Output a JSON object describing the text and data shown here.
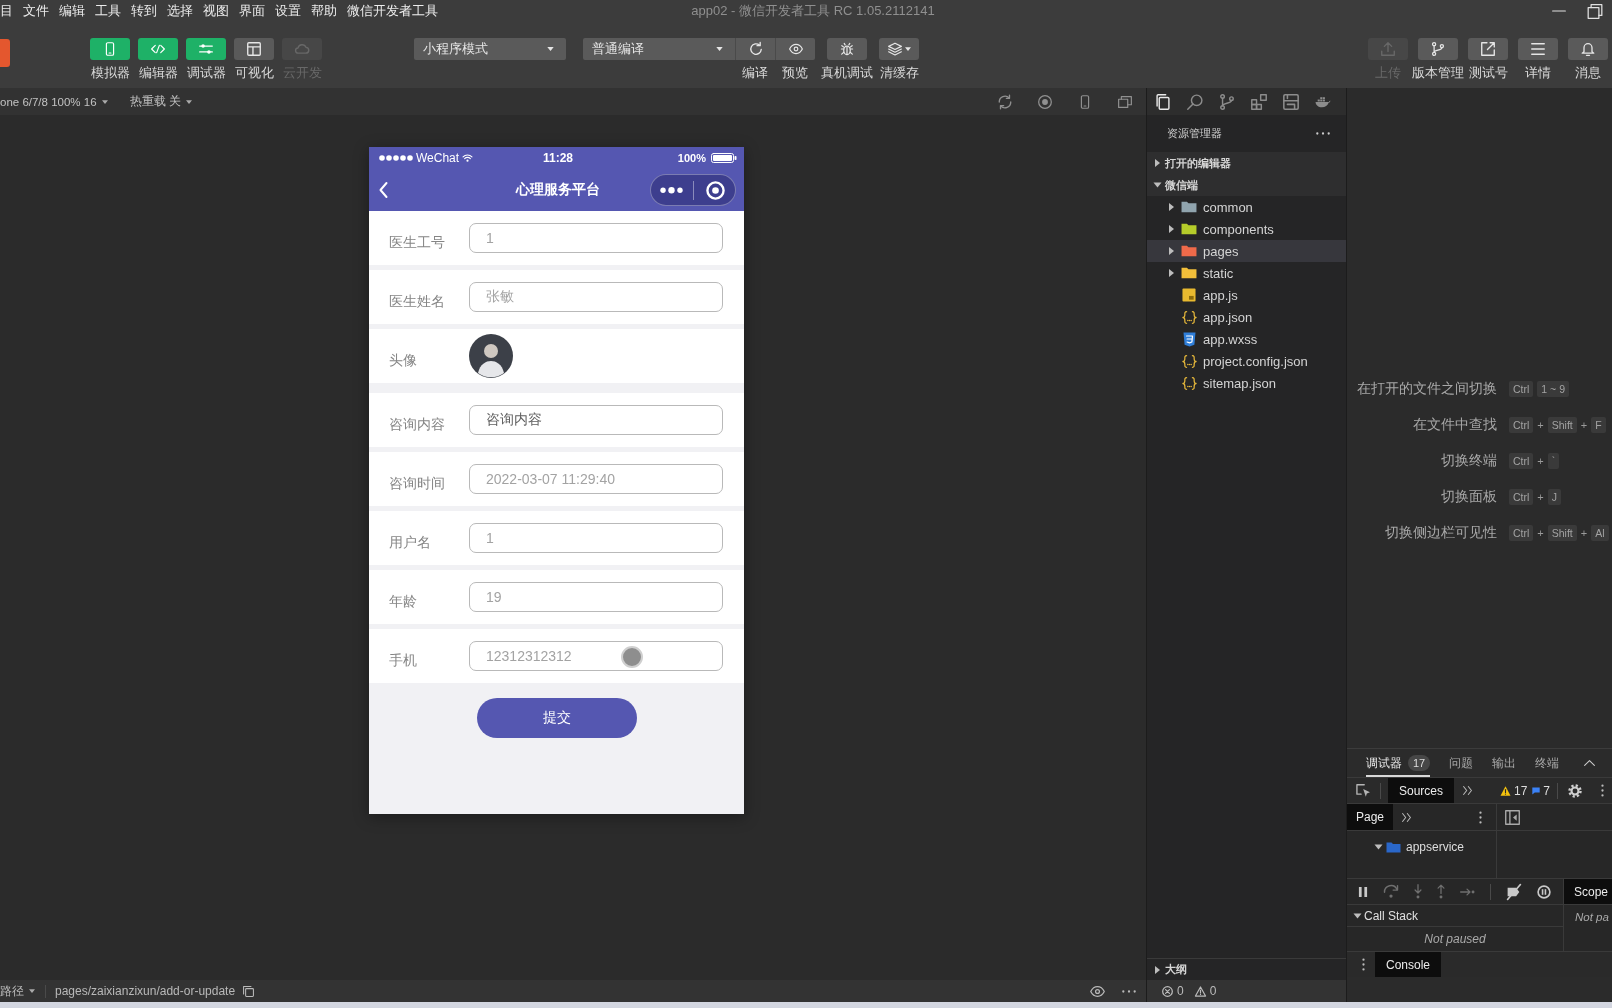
{
  "menu_bar": {
    "items": [
      "目",
      "文件",
      "编辑",
      "工具",
      "转到",
      "选择",
      "视图",
      "界面",
      "设置",
      "帮助",
      "微信开发者工具"
    ],
    "title": "app02 - 微信开发者工具 RC 1.05.2112141"
  },
  "toolbar": {
    "view_toggles": [
      {
        "label": "模拟器",
        "kind": "simulator",
        "on": true,
        "disabled": false
      },
      {
        "label": "编辑器",
        "kind": "editor",
        "on": true,
        "disabled": false
      },
      {
        "label": "调试器",
        "kind": "debugger",
        "on": true,
        "disabled": false
      },
      {
        "label": "可视化",
        "kind": "visual",
        "on": false,
        "disabled": false
      },
      {
        "label": "云开发",
        "kind": "cloud",
        "on": false,
        "disabled": true
      }
    ],
    "mode_select": {
      "value": "小程序模式"
    },
    "compile_select": {
      "value": "普通编译"
    },
    "compile_actions": [
      {
        "label": "编译",
        "kind": "refresh"
      },
      {
        "label": "预览",
        "kind": "preview"
      }
    ],
    "tools": [
      {
        "label": "真机调试",
        "kind": "debug"
      },
      {
        "label": "清缓存",
        "kind": "cache"
      }
    ],
    "right_actions": [
      {
        "label": "上传",
        "kind": "upload",
        "disabled": true
      },
      {
        "label": "版本管理",
        "kind": "version",
        "disabled": false
      },
      {
        "label": "测试号",
        "kind": "test",
        "disabled": false
      },
      {
        "label": "详情",
        "kind": "details",
        "disabled": false
      },
      {
        "label": "消息",
        "kind": "messages",
        "disabled": false
      }
    ]
  },
  "simulator_bar": {
    "device": "one 6/7/8 100% 16",
    "hot_reload": "热重载 关"
  },
  "phone": {
    "status_bar": {
      "carrier": "WeChat",
      "time": "11:28",
      "battery": "100%"
    },
    "nav_title": "心理服务平台",
    "form": [
      {
        "label": "医生工号",
        "kind": "input",
        "value": "1",
        "disabled": true
      },
      {
        "label": "医生姓名",
        "kind": "input",
        "value": "张敏",
        "disabled": true
      },
      {
        "label": "头像",
        "kind": "image"
      },
      {
        "label": "咨询内容",
        "kind": "input",
        "placeholder": "咨询内容",
        "disabled": false
      },
      {
        "label": "咨询时间",
        "kind": "input",
        "value": "2022-03-07 11:29:40",
        "disabled": true
      },
      {
        "label": "用户名",
        "kind": "input",
        "value": "1",
        "disabled": true
      },
      {
        "label": "年龄",
        "kind": "input",
        "value": "19",
        "disabled": true
      },
      {
        "label": "手机",
        "kind": "input",
        "value": "12312312312",
        "disabled": true
      }
    ],
    "submit": "提交"
  },
  "explorer": {
    "title": "资源管理器",
    "sections": [
      {
        "label": "打开的编辑器",
        "expanded": false
      },
      {
        "label": "微信端",
        "expanded": true,
        "children": [
          {
            "label": "common",
            "kind": "folder",
            "color": "#90a4ae",
            "expanded": false,
            "selected": false
          },
          {
            "label": "components",
            "kind": "folder",
            "color": "#b5cc2a",
            "expanded": false,
            "selected": false
          },
          {
            "label": "pages",
            "kind": "folder",
            "color": "#ef6a4a",
            "expanded": false,
            "selected": true
          },
          {
            "label": "static",
            "kind": "folder",
            "color": "#f2bf3a",
            "expanded": false,
            "selected": false
          },
          {
            "label": "app.js",
            "kind": "js",
            "selected": false
          },
          {
            "label": "app.json",
            "kind": "json",
            "selected": false
          },
          {
            "label": "app.wxss",
            "kind": "wxss",
            "selected": false
          },
          {
            "label": "project.config.json",
            "kind": "json",
            "selected": false
          },
          {
            "label": "sitemap.json",
            "kind": "json",
            "selected": false
          }
        ]
      }
    ],
    "outline": {
      "label": "大纲",
      "expanded": false
    },
    "problems": {
      "errors": "0",
      "warnings": "0"
    }
  },
  "shortcuts": [
    {
      "label": "在打开的文件之间切换",
      "keys": [
        {
          "kind": "key",
          "text": "Ctrl"
        },
        {
          "kind": "key",
          "text": "1 ~ 9"
        }
      ]
    },
    {
      "label": "在文件中查找",
      "keys": [
        {
          "kind": "key",
          "text": "Ctrl"
        },
        {
          "kind": "plus",
          "text": "+"
        },
        {
          "kind": "key",
          "text": "Shift"
        },
        {
          "kind": "plus",
          "text": "+"
        },
        {
          "kind": "key",
          "text": "F"
        }
      ]
    },
    {
      "label": "切换终端",
      "keys": [
        {
          "kind": "key",
          "text": "Ctrl"
        },
        {
          "kind": "plus",
          "text": "+"
        },
        {
          "kind": "key",
          "text": "`"
        }
      ]
    },
    {
      "label": "切换面板",
      "keys": [
        {
          "kind": "key",
          "text": "Ctrl"
        },
        {
          "kind": "plus",
          "text": "+"
        },
        {
          "kind": "key",
          "text": "J"
        }
      ]
    },
    {
      "label": "切换侧边栏可见性",
      "keys": [
        {
          "kind": "key",
          "text": "Ctrl"
        },
        {
          "kind": "plus",
          "text": "+"
        },
        {
          "kind": "key",
          "text": "Shift"
        },
        {
          "kind": "plus",
          "text": "+"
        },
        {
          "kind": "key",
          "text": "Al"
        }
      ]
    }
  ],
  "debugger": {
    "tabs": [
      {
        "label": "调试器",
        "badge": "17",
        "selected": true
      },
      {
        "label": "问题",
        "selected": false
      },
      {
        "label": "输出",
        "selected": false
      },
      {
        "label": "终端",
        "selected": false
      }
    ],
    "devtools": {
      "tabs": [
        {
          "label": "Sources",
          "selected": true
        }
      ],
      "warnings": "17",
      "messages": "7"
    },
    "navigator": {
      "tabs": [
        {
          "label": "Page",
          "selected": true
        }
      ],
      "tree": [
        {
          "label": "appservice",
          "expanded": true
        }
      ]
    },
    "call_stack": {
      "label": "Call Stack",
      "expanded": true,
      "message": "Not paused"
    },
    "sidebar": {
      "tabs": [
        {
          "label": "Scope",
          "selected": true
        }
      ],
      "message": "Not pa"
    },
    "drawer": {
      "tabs": [
        {
          "label": "Console",
          "selected": true
        }
      ]
    }
  },
  "status_bar": {
    "path_menu": "路径",
    "path": "pages/zaixianzixun/add-or-update"
  }
}
